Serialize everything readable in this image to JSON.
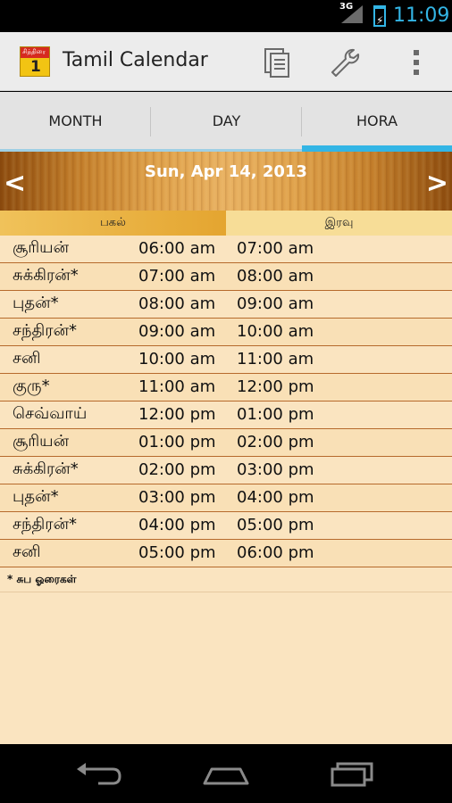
{
  "status_bar": {
    "network": "3G",
    "time": "11:09",
    "icons": [
      "signal-icon",
      "battery-charging-icon"
    ]
  },
  "action_bar": {
    "title": "Tamil Calendar",
    "logo_text": "சித்திரை",
    "logo_number": "1",
    "icons": [
      "copy-icon",
      "wrench-icon",
      "overflow-menu-icon"
    ]
  },
  "tabs": [
    {
      "label": "MONTH",
      "active": false
    },
    {
      "label": "DAY",
      "active": false
    },
    {
      "label": "HORA",
      "active": true
    }
  ],
  "date_bar": {
    "date": "Sun, Apr 14, 2013",
    "prev_label": "<",
    "next_label": ">"
  },
  "columns": {
    "day": "பகல்",
    "night": "இரவு"
  },
  "hora_rows": [
    {
      "planet": "சூரியன்",
      "day_time": "06:00 am",
      "night_time": "07:00 am"
    },
    {
      "planet": "சுக்கிரன்*",
      "day_time": "07:00 am",
      "night_time": "08:00 am"
    },
    {
      "planet": "புதன்*",
      "day_time": "08:00 am",
      "night_time": "09:00 am"
    },
    {
      "planet": "சந்திரன்*",
      "day_time": "09:00 am",
      "night_time": "10:00 am"
    },
    {
      "planet": "சனி",
      "day_time": "10:00 am",
      "night_time": "11:00 am"
    },
    {
      "planet": "குரு*",
      "day_time": "11:00 am",
      "night_time": "12:00 pm"
    },
    {
      "planet": "செவ்வாய்",
      "day_time": "12:00 pm",
      "night_time": "01:00 pm"
    },
    {
      "planet": "சூரியன்",
      "day_time": "01:00 pm",
      "night_time": "02:00 pm"
    },
    {
      "planet": "சுக்கிரன்*",
      "day_time": "02:00 pm",
      "night_time": "03:00 pm"
    },
    {
      "planet": "புதன்*",
      "day_time": "03:00 pm",
      "night_time": "04:00 pm"
    },
    {
      "planet": "சந்திரன்*",
      "day_time": "04:00 pm",
      "night_time": "05:00 pm"
    },
    {
      "planet": "சனி",
      "day_time": "05:00 pm",
      "night_time": "06:00 pm"
    }
  ],
  "footnote": "* சுப ஓரைகள்",
  "nav_bar": {
    "icons": [
      "back-icon",
      "home-icon",
      "recent-apps-icon"
    ]
  },
  "colors": {
    "accent": "#33b5e5",
    "list_background": "#fae4c0",
    "row_divider": "#b66a2c"
  }
}
